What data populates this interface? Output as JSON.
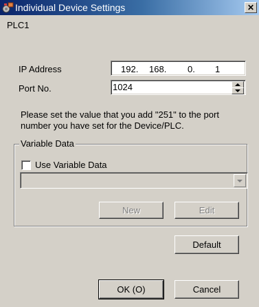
{
  "window": {
    "title": "Individual Device Settings",
    "close_glyph": "✕"
  },
  "device_name": "PLC1",
  "ip_address": {
    "label": "IP Address",
    "octets": [
      "192.",
      "168.",
      "0.",
      "1"
    ]
  },
  "port": {
    "label": "Port No.",
    "value": "1024"
  },
  "note": {
    "line1": "Please set the value that you add  \"251\"  to the port",
    "line2": "number you have set for the Device/PLC."
  },
  "variable_data": {
    "group_title": "Variable Data",
    "checkbox_label": "Use Variable Data",
    "checkbox_checked": false,
    "combo_value": "",
    "new_label": "New",
    "edit_label": "Edit"
  },
  "buttons": {
    "default_label": "Default",
    "ok_label": "OK (O)",
    "cancel_label": "Cancel"
  },
  "colors": {
    "title_start": "#0a246a",
    "title_end": "#a6caf0",
    "face": "#d4d0c8"
  },
  "icons": {
    "title": "device-settings-icon",
    "spin_up": "arrow-up-icon",
    "spin_down": "arrow-down-icon",
    "dropdown": "dropdown-arrow-icon"
  }
}
